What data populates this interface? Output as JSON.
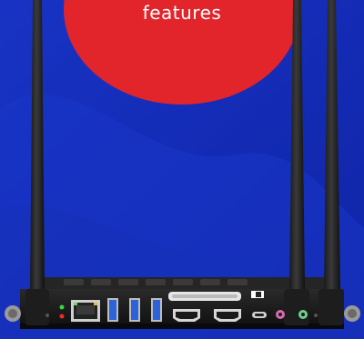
{
  "badge": {
    "text": "features",
    "color": "#e1252b"
  },
  "background": {
    "primary_color": "#1a2fb8",
    "secondary_color": "#0e22a3"
  },
  "device": {
    "description_icon": "mini-pc-with-antennas",
    "ports": [
      "ethernet-port",
      "usb-port",
      "usb-port",
      "usb-port",
      "hdmi-port",
      "hdmi-port",
      "usb-c-port",
      "audio-jack",
      "audio-jack"
    ]
  }
}
